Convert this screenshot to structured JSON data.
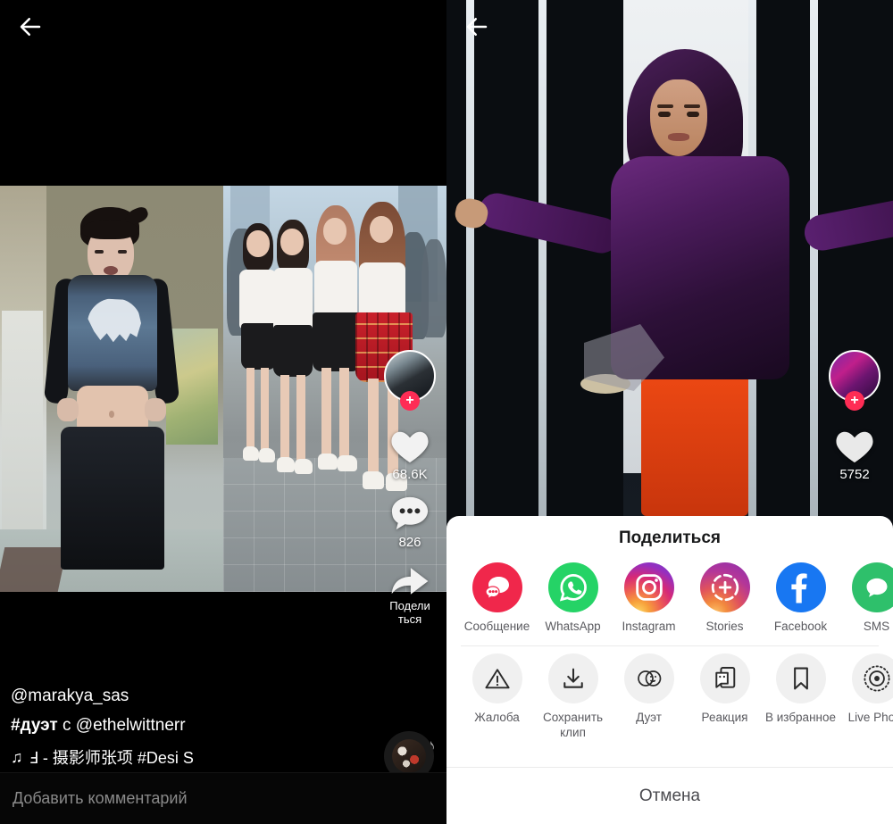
{
  "left_panel": {
    "back_icon": "back-arrow-icon",
    "rail": {
      "follow_plus": "+",
      "like_icon": "heart-icon",
      "like_count": "68.6K",
      "comment_icon": "comment-icon",
      "comment_count": "826",
      "share_icon": "share-arrow-icon",
      "share_label_line1": "Подели",
      "share_label_line2": "ться"
    },
    "caption": {
      "username": "@marakya_sas",
      "hashtag": "#дуэт",
      "hashtag_rest": " с @ethelwittnerr",
      "music_note_icon": "music-note-icon",
      "music_text": "Ⅎ - 摄影师张项    #Desi S"
    },
    "floating_notes": [
      "♪",
      "♫"
    ],
    "disc_icon": "album-disc-icon",
    "comment_bar": {
      "placeholder": "Добавить комментарий"
    }
  },
  "right_panel": {
    "back_icon": "back-arrow-icon",
    "rail": {
      "follow_plus": "+",
      "like_icon": "heart-icon",
      "like_count": "5752"
    }
  },
  "share_sheet": {
    "title": "Поделиться",
    "apps": [
      {
        "label": "Сообщение",
        "icon": "message-bubble-icon",
        "color": "#f0274b"
      },
      {
        "label": "WhatsApp",
        "icon": "whatsapp-icon",
        "color": "#25d366"
      },
      {
        "label": "Instagram",
        "icon": "instagram-icon",
        "color": "#d62976"
      },
      {
        "label": "Stories",
        "icon": "stories-plus-icon",
        "color": "#a233a8"
      },
      {
        "label": "Facebook",
        "icon": "facebook-icon",
        "color": "#1877f2"
      },
      {
        "label": "SMS",
        "icon": "sms-bubble-icon",
        "color": "#2ec06b"
      }
    ],
    "actions": [
      {
        "label": "Жалоба",
        "icon": "warning-triangle-icon"
      },
      {
        "label": "Сохранить клип",
        "icon": "download-icon"
      },
      {
        "label": "Дуэт",
        "icon": "duet-circles-icon"
      },
      {
        "label": "Реакция",
        "icon": "reaction-icon"
      },
      {
        "label": "В избранное",
        "icon": "bookmark-icon"
      },
      {
        "label": "Live Photo",
        "icon": "live-photo-icon"
      }
    ],
    "cancel_label": "Отмена"
  },
  "colors": {
    "accent_pink": "#fe2c55",
    "sheet_bg": "#ffffff",
    "app_bg": "#000000"
  }
}
